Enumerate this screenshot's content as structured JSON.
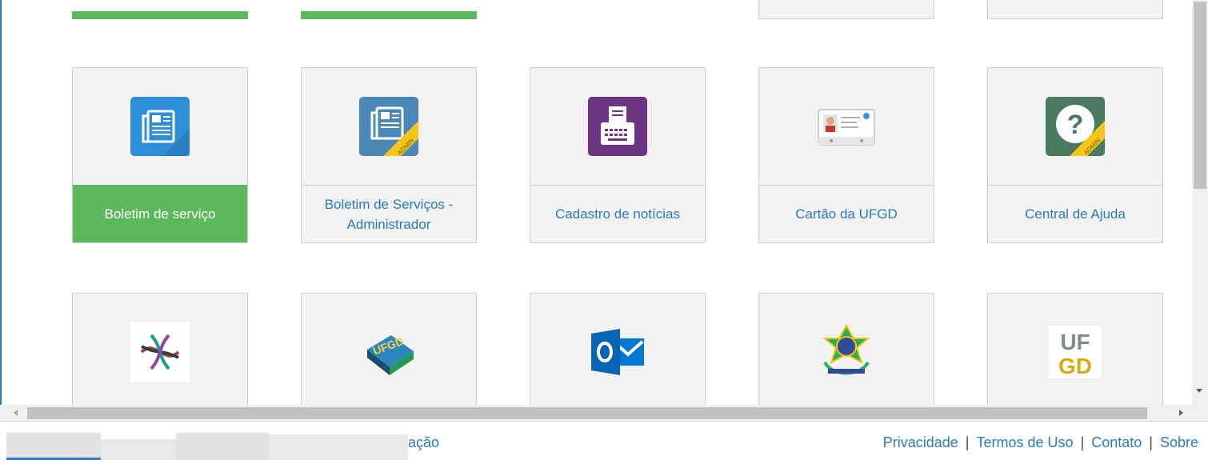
{
  "tiles_row1": [
    {
      "label": "Boletim de serviço",
      "icon": "newspaper-icon",
      "active": true
    },
    {
      "label": "Boletim de Serviços - Administrador",
      "icon": "newspaper-admin-icon",
      "active": false
    },
    {
      "label": "Cadastro de notícias",
      "icon": "typewriter-icon",
      "active": false
    },
    {
      "label": "Cartão da UFGD",
      "icon": "id-card-icon",
      "active": false
    },
    {
      "label": "Central de Ajuda",
      "icon": "help-admin-icon",
      "active": false
    }
  ],
  "tiles_row2": [
    {
      "icon": "colorful-asterisk-logo-icon"
    },
    {
      "icon": "ufgd-books-icon"
    },
    {
      "icon": "outlook-icon"
    },
    {
      "icon": "brazil-coat-of-arms-icon"
    },
    {
      "icon": "ufgd-logo-icon"
    }
  ],
  "badges": {
    "admin": "ADMIN"
  },
  "footer": {
    "left_text": "ação",
    "links": [
      "Privacidade",
      "Termos de Uso",
      "Contato",
      "Sobre"
    ],
    "separator": "|"
  },
  "colors": {
    "active_green": "#5cb85c",
    "link_blue": "#2a7ab8",
    "tile_bg": "#f2f2f2",
    "tile_border": "#cfcfcf"
  }
}
